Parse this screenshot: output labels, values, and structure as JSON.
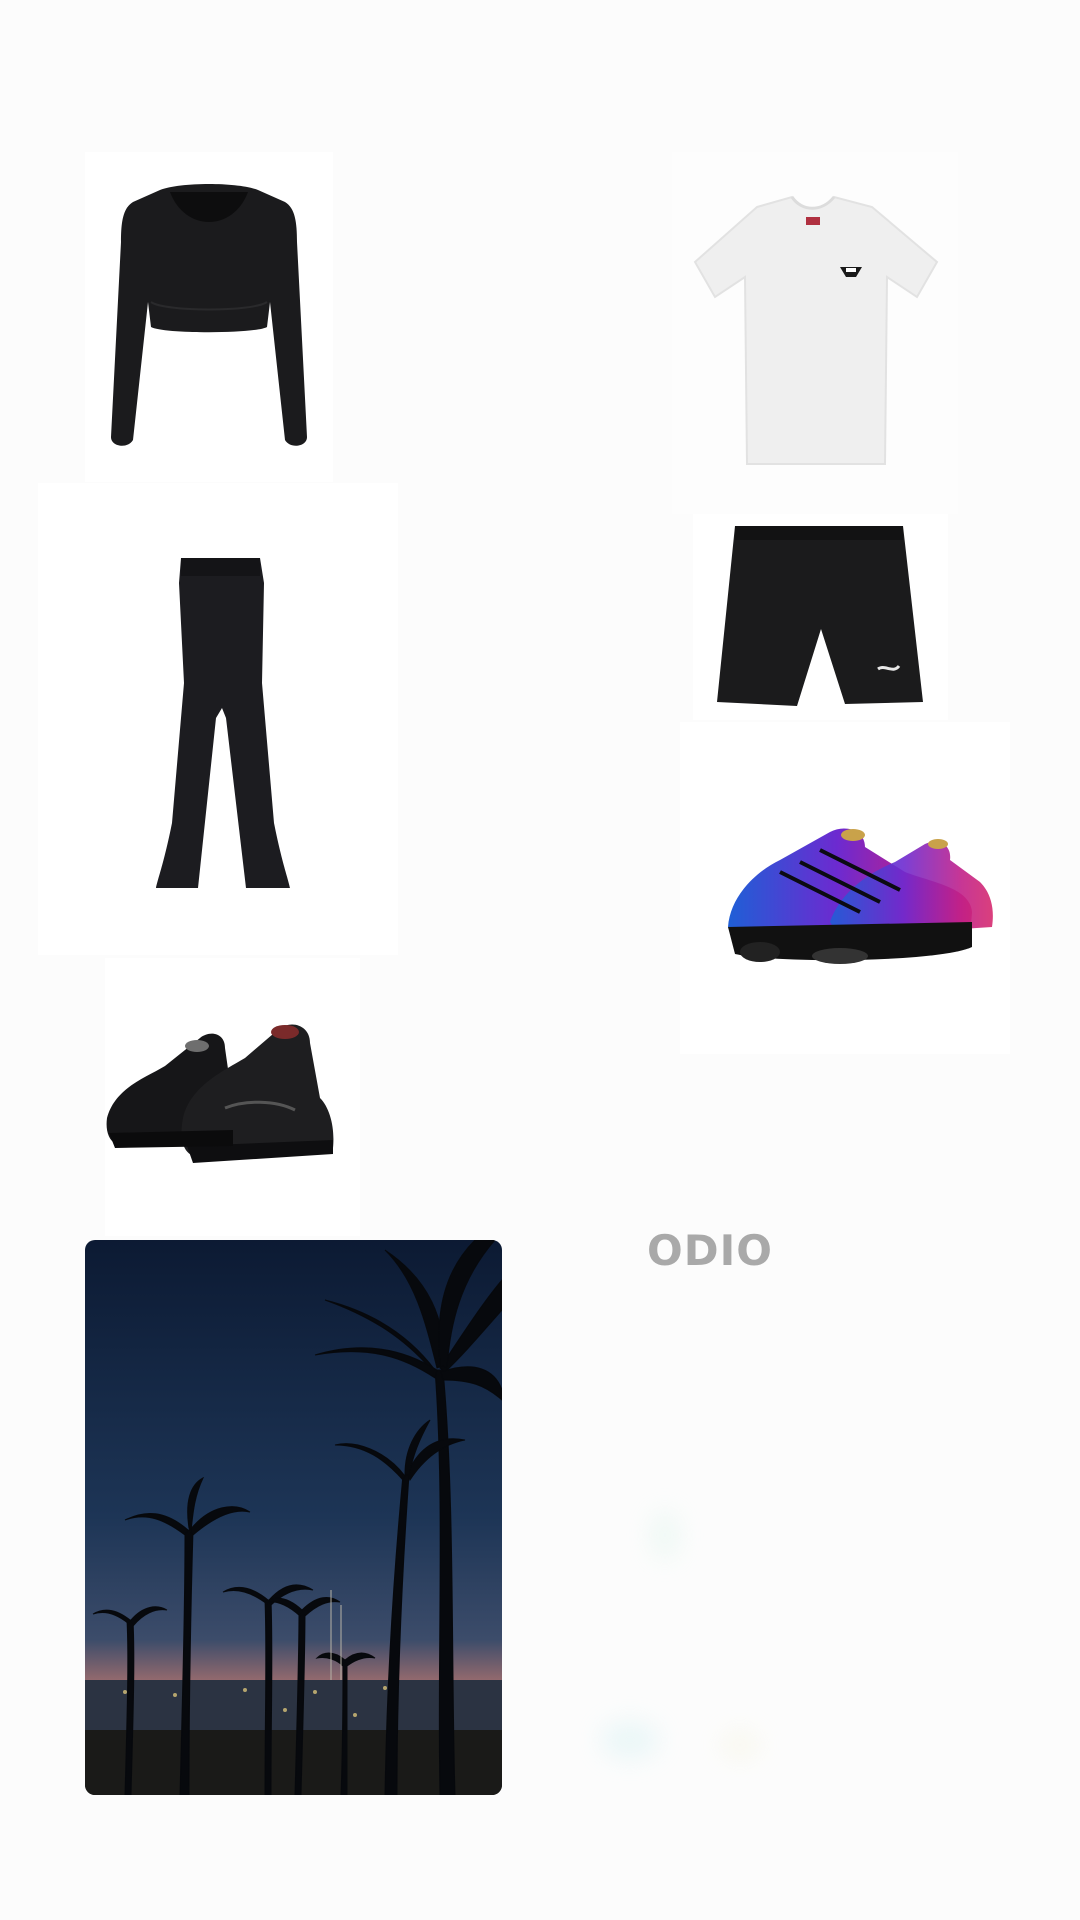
{
  "moodboard": {
    "caption": "ODIO",
    "items": [
      {
        "name": "black-crop-top",
        "icon": "long-sleeve-crop-top"
      },
      {
        "name": "black-flare-pants",
        "icon": "flare-leggings"
      },
      {
        "name": "black-sneakers",
        "icon": "sneakers"
      },
      {
        "name": "white-tee",
        "icon": "t-shirt"
      },
      {
        "name": "black-shorts",
        "icon": "shorts"
      },
      {
        "name": "iridescent-sneakers",
        "icon": "sneakers"
      },
      {
        "name": "night-palm-photo",
        "icon": "photo"
      }
    ],
    "colors": {
      "background": "#fcfcfc",
      "caption": "#a9a9a9",
      "garment_black": "#1a1a1c",
      "sky_top": "#0d1a33",
      "sky_horizon": "#e38b6a"
    }
  }
}
